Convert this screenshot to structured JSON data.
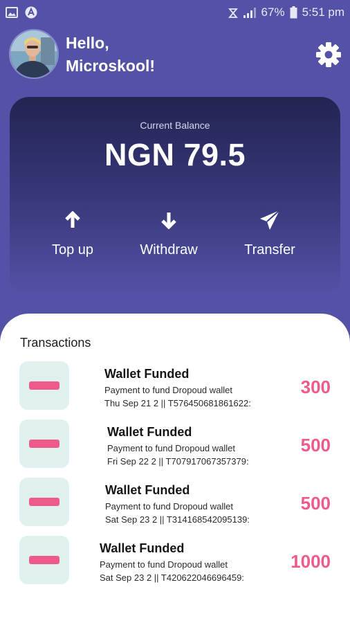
{
  "status_bar": {
    "battery": "67%",
    "time": "5:51 pm",
    "icons": [
      "gallery-icon",
      "a-badge-icon",
      "alarm-icon",
      "signal-icon",
      "battery-icon"
    ]
  },
  "header": {
    "greeting_line1": "Hello,",
    "greeting_line2": "Microskool!",
    "settings_icon": "gear-icon"
  },
  "balance": {
    "label": "Current Balance",
    "value": "NGN 79.5"
  },
  "actions": [
    {
      "label": "Top up",
      "icon": "arrow-up-icon"
    },
    {
      "label": "Withdraw",
      "icon": "arrow-down-icon"
    },
    {
      "label": "Transfer",
      "icon": "send-icon"
    }
  ],
  "transactions": {
    "title": "Transactions",
    "items": [
      {
        "title": "Wallet Funded",
        "description": "Payment to fund Dropoud wallet",
        "meta": "Thu Sep 21 2 ||  T576450681861622:",
        "amount": "300"
      },
      {
        "title": "Wallet Funded",
        "description": "Payment to fund Dropoud wallet",
        "meta": "Fri Sep 22 2 ||  T707917067357379:",
        "amount": "500"
      },
      {
        "title": "Wallet Funded",
        "description": "Payment to fund Dropoud wallet",
        "meta": "Sat Sep 23 2 ||  T314168542095139:",
        "amount": "500"
      },
      {
        "title": "Wallet Funded",
        "description": "Payment to fund Dropoud wallet",
        "meta": "Sat Sep 23 2 ||  T420622046696459:",
        "amount": "1000"
      }
    ]
  },
  "colors": {
    "background": "#5452a6",
    "card_top": "#232452",
    "accent_pink": "#ee5a8a",
    "icon_tile": "#e0f0ef"
  }
}
